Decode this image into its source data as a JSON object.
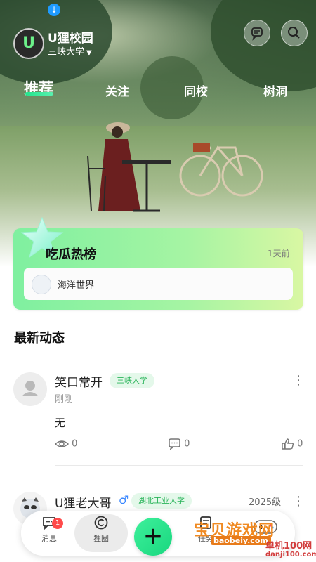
{
  "header": {
    "app_title": "U狸校园",
    "avatar_letter": "U",
    "school": "三峡大学"
  },
  "tabs": [
    {
      "label": "推荐"
    },
    {
      "label": "关注"
    },
    {
      "label": "同校"
    },
    {
      "label": "树洞"
    }
  ],
  "hot_card": {
    "title": "吃瓜热榜",
    "time": "1天前",
    "item": "海洋世界"
  },
  "section": {
    "title": "最新动态"
  },
  "posts": [
    {
      "name": "笑口常开",
      "school": "三峡大学",
      "time": "刚刚",
      "content": "无",
      "views": "0",
      "comments": "0",
      "likes": "0"
    },
    {
      "name": "U狸老大哥",
      "gender": "♂",
      "school": "湖北工业大学",
      "grade": "2025级"
    }
  ],
  "tabbar": {
    "messages": "消息",
    "messages_badge": "1",
    "circle": "狸圈",
    "add": "+",
    "tasks": "任务"
  },
  "watermark": {
    "site1": "宝贝游戏网",
    "site1_url": "baobeiy.com",
    "site2": "单机100网",
    "site2_url": "danji100.com"
  },
  "colors": {
    "accent": "#22e58c",
    "tag_bg": "#e4f8ea",
    "tag_text": "#2ab45a"
  }
}
